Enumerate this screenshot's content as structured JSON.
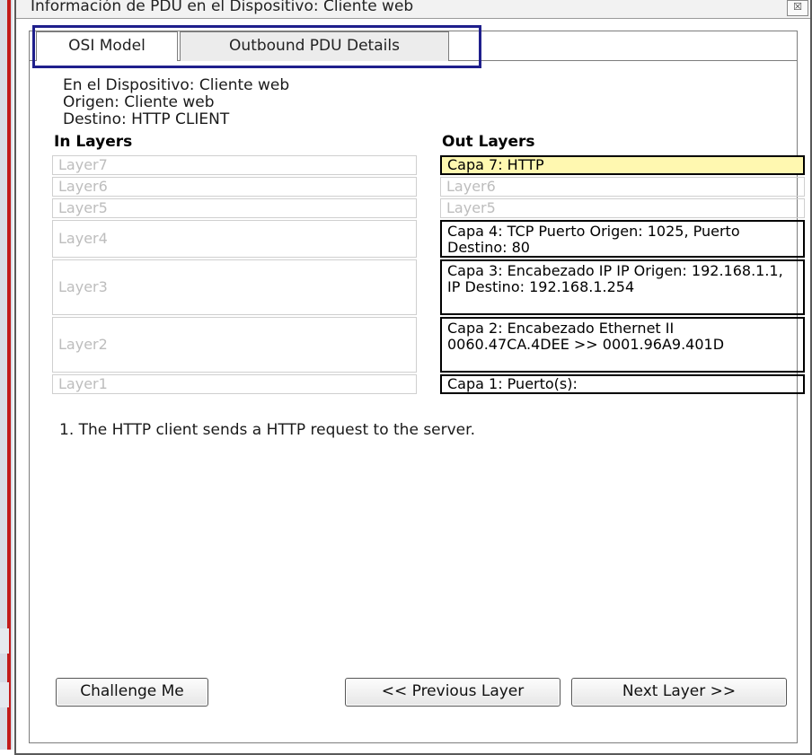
{
  "window": {
    "title": "Información de PDU en el Dispositivo: Cliente web",
    "close_label": "☒"
  },
  "tabs": [
    {
      "label": "OSI Model",
      "active": true
    },
    {
      "label": "Outbound PDU Details",
      "active": false
    }
  ],
  "info": {
    "device_line": "En el Dispositivo: Cliente web",
    "origin_line": "Origen: Cliente web",
    "destination_line": "Destino: HTTP CLIENT"
  },
  "in_layers": {
    "heading": "In Layers",
    "items": [
      "Layer7",
      "Layer6",
      "Layer5",
      "Layer4",
      "Layer3",
      "Layer2",
      "Layer1"
    ]
  },
  "out_layers": {
    "heading": "Out Layers",
    "items": [
      "Capa 7: HTTP",
      "Layer6",
      "Layer5",
      "Capa 4: TCP Puerto Origen: 1025, Puerto Destino: 80",
      "Capa 3: Encabezado IP IP Origen: 192.168.1.1, IP Destino: 192.168.1.254",
      "Capa 2: Encabezado Ethernet II 0060.47CA.4DEE >> 0001.96A9.401D",
      "Capa 1: Puerto(s):"
    ],
    "selected_index": 0
  },
  "description": "1. The HTTP client sends a HTTP request to the server.",
  "buttons": {
    "challenge": "Challenge Me",
    "previous": "<< Previous Layer",
    "next": "Next Layer >>"
  },
  "colors": {
    "selected_layer": "#fff8b0",
    "tab_highlight": "#1f1f8c",
    "background_edge": "#c21b1b"
  }
}
